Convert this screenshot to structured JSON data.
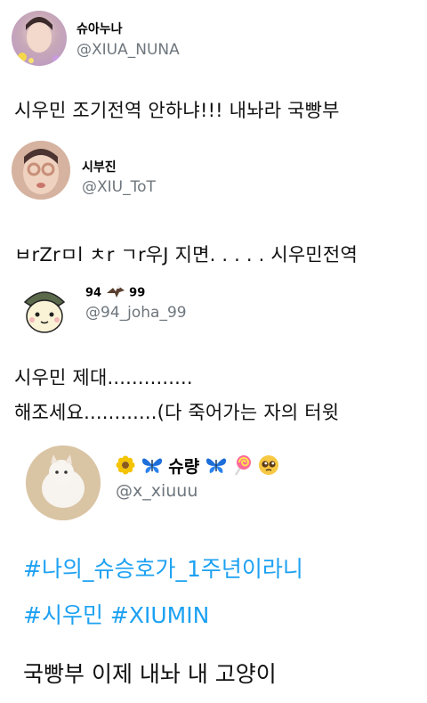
{
  "tweets": [
    {
      "name": "슈아누나",
      "handle": "@XIUA_NUNA",
      "text": "시우민 조기전역 안하냐!!! 내놔라 국빵부"
    },
    {
      "name": "시부진",
      "handle": "@XIU_ToT",
      "text": "ㅂrZrㅁl ㅊr ㄱr우J 지면. . . . . 시우민전역"
    },
    {
      "name_left": "94",
      "name_right": "99",
      "handle": "@94_joha_99",
      "text_line1": "시우민 제대..............",
      "text_line2": "해조세요............(다 죽어가는 자의 터윗"
    },
    {
      "name": "슈량",
      "handle": "@x_xiuuu",
      "hashtag_line1": "#나의_슈승호가_1주년이라니",
      "hashtag_line2": "#시우민 #XIUMIN",
      "text": "국빵부 이제 내놔 내 고양이"
    }
  ],
  "colors": {
    "hashtag": "#1da1f2",
    "handle": "#6e767d",
    "butterfly": "#1e6fd9"
  },
  "icons": [
    "flower-emoji",
    "butterfly-emoji",
    "lollipop-emoji",
    "pleading-face-emoji",
    "eagle-emoji"
  ]
}
